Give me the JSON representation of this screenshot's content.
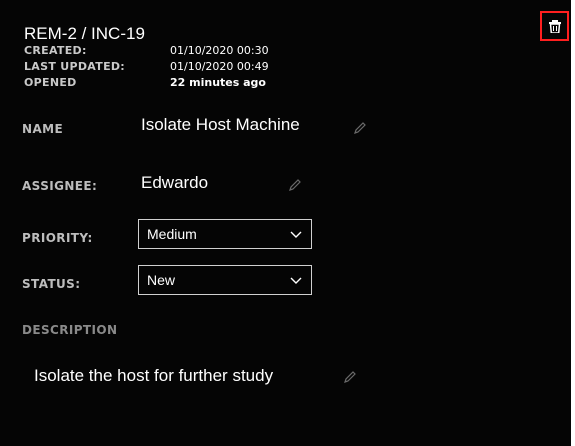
{
  "header": {
    "title": "REM-2 / INC-19",
    "created_label": "CREATED:",
    "created_value": "01/10/2020 00:30",
    "updated_label": "LAST UPDATED:",
    "updated_value": "01/10/2020 00:49",
    "opened_label": "OPENED",
    "opened_value": "22 minutes ago"
  },
  "fields": {
    "name_label": "NAME",
    "name_value": "Isolate Host Machine",
    "assignee_label": "ASSIGNEE:",
    "assignee_value": "Edwardo",
    "priority_label": "PRIORITY:",
    "priority_value": "Medium",
    "status_label": "STATUS:",
    "status_value": "New",
    "description_label": "DESCRIPTION",
    "description_value": "Isolate the host for further study"
  },
  "icons": {
    "delete": "trash-icon",
    "edit": "pencil-icon",
    "dropdown": "chevron-down-icon"
  },
  "colors": {
    "background": "#050505",
    "text": "#ffffff",
    "label": "#bdbdbd",
    "highlight": "#ff1f1f"
  }
}
